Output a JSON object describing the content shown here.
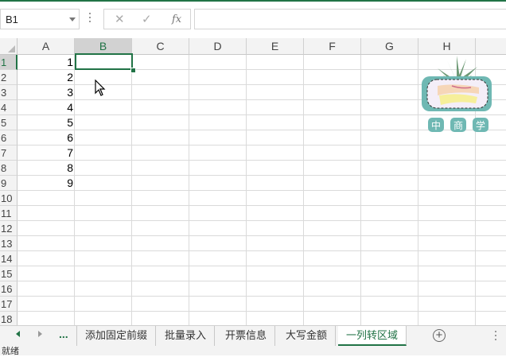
{
  "formula_bar": {
    "name_box": "B1",
    "cancel_glyph": "✕",
    "enter_glyph": "✓",
    "fx_label": "fx",
    "formula_value": ""
  },
  "columns": [
    "A",
    "B",
    "C",
    "D",
    "E",
    "F",
    "G",
    "H"
  ],
  "rows": [
    "1",
    "2",
    "3",
    "4",
    "5",
    "6",
    "7",
    "8",
    "9",
    "10",
    "11",
    "12",
    "13",
    "14",
    "15",
    "16",
    "17",
    "18"
  ],
  "selected_cell": {
    "column": "B",
    "row": "1"
  },
  "column_a_values": [
    "1",
    "2",
    "3",
    "4",
    "5",
    "6",
    "7",
    "8",
    "9"
  ],
  "logo": {
    "chars": [
      "中",
      "商",
      "学"
    ],
    "accent": "#6fb8b3",
    "pot_color": "#e8e2f0"
  },
  "sheet_tabs": {
    "overflow_label": "...",
    "tabs": [
      "添加固定前缀",
      "批量录入",
      "开票信息",
      "大写金额",
      "一列转区域"
    ],
    "active_index": 4,
    "add_label": "+"
  },
  "status_bar": {
    "text": "就绪"
  },
  "colors": {
    "accent": "#217346",
    "header_bg": "#f3f3f3",
    "selected_header_bg": "#d2d2d2"
  }
}
